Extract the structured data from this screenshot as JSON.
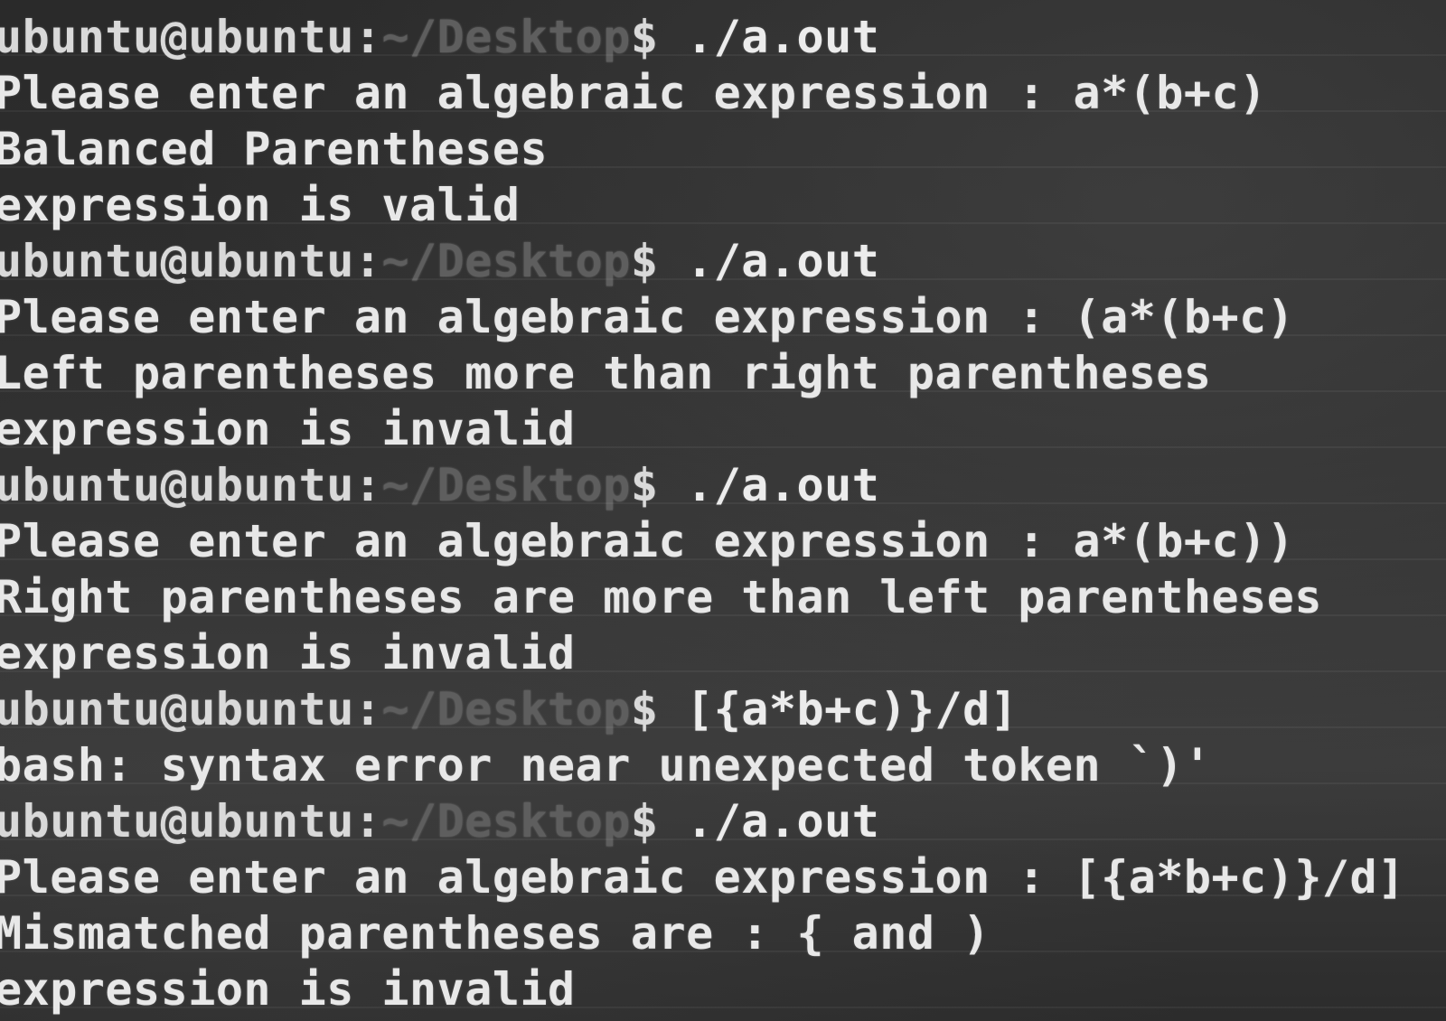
{
  "prompt": {
    "user_host": "ubuntu@ubuntu:",
    "path": "~/Desktop",
    "symbol": "$"
  },
  "lines": [
    {
      "type": "prompt",
      "command": " ./a.out"
    },
    {
      "type": "output",
      "text": "Please enter an algebraic expression : a*(b+c)"
    },
    {
      "type": "output",
      "text": "Balanced Parentheses"
    },
    {
      "type": "output",
      "text": "expression is valid"
    },
    {
      "type": "prompt",
      "command": " ./a.out"
    },
    {
      "type": "output",
      "text": "Please enter an algebraic expression : (a*(b+c)"
    },
    {
      "type": "output",
      "text": "Left parentheses more than right parentheses"
    },
    {
      "type": "output",
      "text": "expression is invalid"
    },
    {
      "type": "prompt",
      "command": " ./a.out"
    },
    {
      "type": "output",
      "text": "Please enter an algebraic expression : a*(b+c))"
    },
    {
      "type": "output",
      "text": "Right parentheses are more than left parentheses"
    },
    {
      "type": "output",
      "text": "expression is invalid"
    },
    {
      "type": "prompt",
      "command": " [{a*b+c)}/d]"
    },
    {
      "type": "output",
      "text": "bash: syntax error near unexpected token `)'"
    },
    {
      "type": "prompt",
      "command": " ./a.out"
    },
    {
      "type": "output",
      "text": "Please enter an algebraic expression : [{a*b+c)}/d]"
    },
    {
      "type": "output",
      "text": "Mismatched parentheses are : { and )"
    },
    {
      "type": "output",
      "text": "expression is invalid"
    }
  ]
}
